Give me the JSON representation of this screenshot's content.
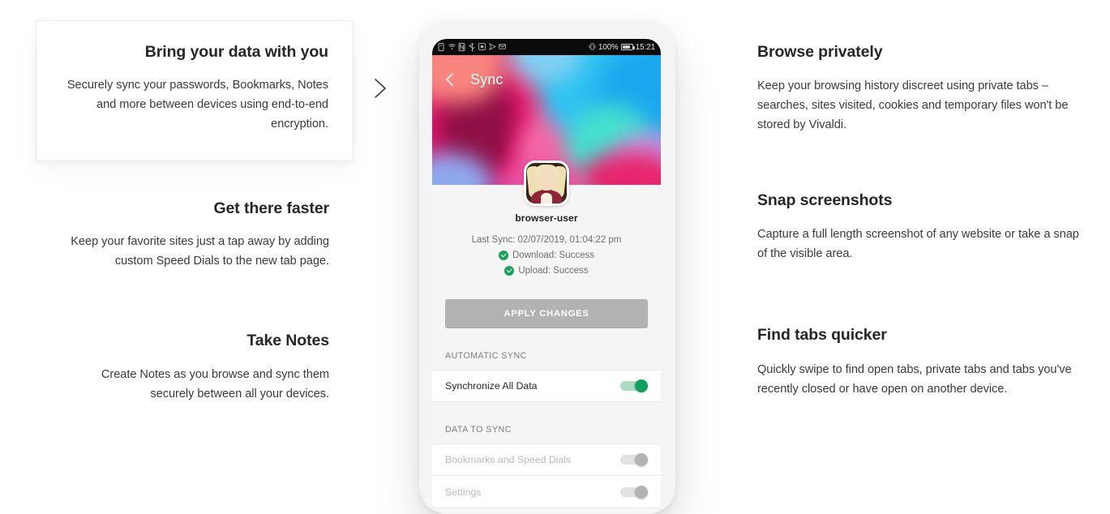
{
  "page": {
    "background": "#ffffff",
    "accent_green": "#0fa15c",
    "text_dark": "#262626",
    "text_body": "#3a3a3a"
  },
  "left_column": {
    "features": [
      {
        "title": "Bring your data with you",
        "body": "Securely sync your passwords, Bookmarks, Notes and more between devices using end-to-end encryption.",
        "carded": true
      },
      {
        "title": "Get there faster",
        "body": "Keep your favorite sites just a tap away by adding custom Speed Dials to the new tab page.",
        "carded": false
      },
      {
        "title": "Take Notes",
        "body": "Create Notes as you browse and sync them securely between all your devices.",
        "carded": false
      }
    ]
  },
  "next_arrow": {
    "icon": "chevron-right-icon",
    "label": "Next"
  },
  "right_column": {
    "features": [
      {
        "title": "Browse privately",
        "body": "Keep your browsing history discreet using private tabs – searches, sites visited, cookies and temporary files won't be stored by Vivaldi."
      },
      {
        "title": "Snap screenshots",
        "body": "Capture a full length screenshot of any website or take a snap of the visible area."
      },
      {
        "title": "Find tabs quicker",
        "body": "Quickly swipe to find open tabs, private tabs and tabs you've recently closed or have open on another device."
      }
    ]
  },
  "phone": {
    "status_bar": {
      "left_icons": [
        "document-icon",
        "wifi-icon",
        "nfc-icon",
        "usb-icon",
        "screenshot-icon",
        "send-icon",
        "mail-icon"
      ],
      "vibrate_icon": "vibrate-icon",
      "battery_percent": "100%",
      "battery_icon": "battery-icon",
      "clock": "15:21"
    },
    "header": {
      "back_icon": "chevron-left-icon",
      "title": "Sync"
    },
    "profile": {
      "avatar_icon": "user-avatar",
      "username": "browser-user",
      "last_sync": "Last Sync: 02/07/2019, 01:04:22 pm",
      "statuses": [
        {
          "icon": "check-circle-icon",
          "label": "Download: Success"
        },
        {
          "icon": "check-circle-icon",
          "label": "Upload: Success"
        }
      ]
    },
    "apply_button": {
      "label": "APPLY CHANGES",
      "color": "#b2b2b4"
    },
    "sections": [
      {
        "heading": "AUTOMATIC SYNC",
        "rows": [
          {
            "label": "Synchronize All Data",
            "toggle": "on",
            "disabled": false
          }
        ]
      },
      {
        "heading": "DATA TO SYNC",
        "rows": [
          {
            "label": "Bookmarks and Speed Dials",
            "toggle": "on",
            "disabled": true
          },
          {
            "label": "Settings",
            "toggle": "on",
            "disabled": true
          }
        ]
      }
    ]
  }
}
